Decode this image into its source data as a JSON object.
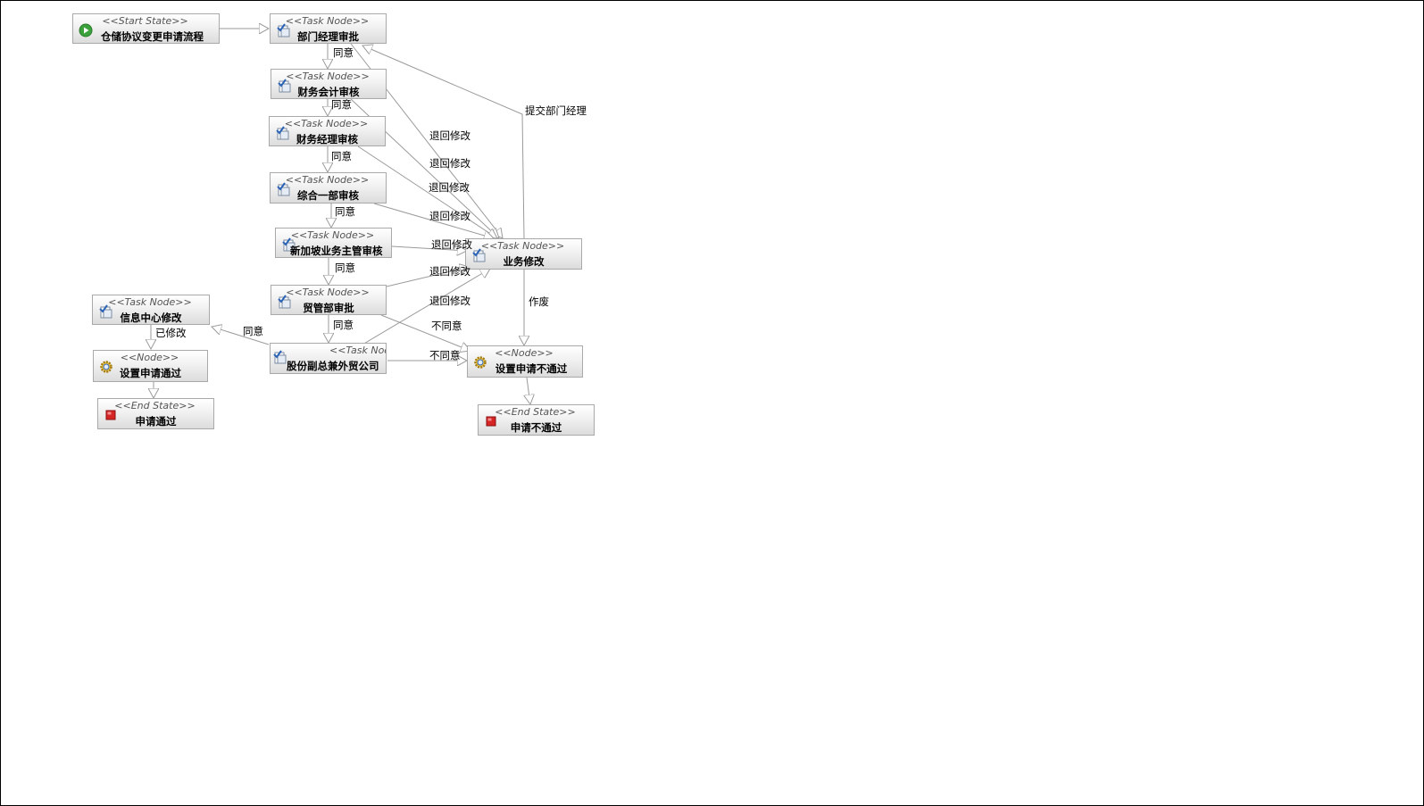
{
  "workflow": {
    "nodes": {
      "start": {
        "stereotype": "<<Start State>>",
        "name": "仓储协议变更申请流程",
        "icon": "play-icon"
      },
      "dept_mgr": {
        "stereotype": "<<Task Node>>",
        "name": "部门经理审批",
        "icon": "task-icon"
      },
      "fin_acct": {
        "stereotype": "<<Task Node>>",
        "name": "财务会计审核",
        "icon": "task-icon"
      },
      "fin_mgr": {
        "stereotype": "<<Task Node>>",
        "name": "财务经理审核",
        "icon": "task-icon"
      },
      "general1": {
        "stereotype": "<<Task Node>>",
        "name": "综合一部审核",
        "icon": "task-icon"
      },
      "sg_super": {
        "stereotype": "<<Task Node>>",
        "name": "新加坡业务主管审核",
        "icon": "task-icon"
      },
      "trade_dept": {
        "stereotype": "<<Task Node>>",
        "name": "贸管部审批",
        "icon": "task-icon"
      },
      "vp": {
        "stereotype": "<<Task Node>>",
        "name": "股份副总兼外贸公司",
        "icon": "task-icon"
      },
      "info_center": {
        "stereotype": "<<Task Node>>",
        "name": "信息中心修改",
        "icon": "task-icon"
      },
      "set_pass": {
        "stereotype": "<<Node>>",
        "name": "设置申请通过",
        "icon": "gear-icon"
      },
      "end_pass": {
        "stereotype": "<<End State>>",
        "name": "申请通过",
        "icon": "stop-icon"
      },
      "biz_modify": {
        "stereotype": "<<Task Node>>",
        "name": "业务修改",
        "icon": "task-icon"
      },
      "set_fail": {
        "stereotype": "<<Node>>",
        "name": "设置申请不通过",
        "icon": "gear-icon"
      },
      "end_fail": {
        "stereotype": "<<End State>>",
        "name": "申请不通过",
        "icon": "stop-icon"
      }
    },
    "labels": {
      "agree": "同意",
      "return_modify": "退回修改",
      "submit_dept_mgr": "提交部门经理",
      "void": "作废",
      "disagree": "不同意",
      "modified": "已修改"
    },
    "colors": {
      "node_border": "#a9a9a9",
      "edge": "#9a9a9a",
      "task_icon": "#2a62b5",
      "start_icon": "#3ba13b",
      "end_icon": "#d62525",
      "gear_icon": "#d8a21a"
    }
  }
}
